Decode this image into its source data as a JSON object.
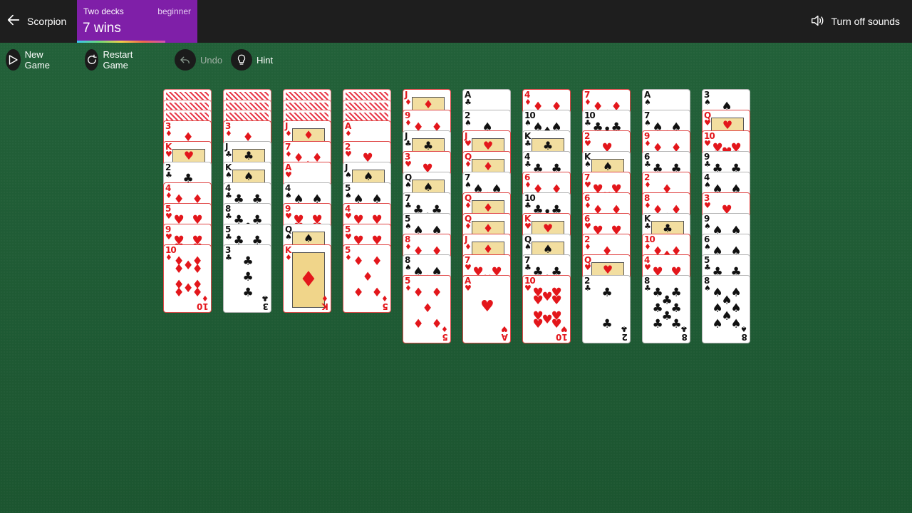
{
  "header": {
    "game_title": "Scorpion",
    "decks": "Two decks",
    "level": "beginner",
    "wins": "7 wins",
    "sound": "Turn off sounds"
  },
  "toolbar": {
    "new_game": "New Game",
    "restart": "Restart Game",
    "undo": "Undo",
    "hint": "Hint"
  },
  "columns": [
    {
      "down": 3,
      "up": [
        "3♦",
        "K♥",
        "2♣",
        "4♦",
        "5♥",
        "9♥",
        "10♦"
      ]
    },
    {
      "down": 3,
      "up": [
        "3♦",
        "J♣",
        "K♠",
        "4♣",
        "8♣",
        "5♣",
        "3♣"
      ]
    },
    {
      "down": 3,
      "up": [
        "J♦",
        "7♦",
        "A♥",
        "4♠",
        "9♥",
        "Q♠",
        "K♦"
      ]
    },
    {
      "down": 3,
      "up": [
        "A♦",
        "2♥",
        "J♠",
        "5♠",
        "4♥",
        "5♥",
        "5♦"
      ]
    },
    {
      "down": 0,
      "up": [
        "J♦",
        "9♦",
        "J♣",
        "3♥",
        "Q♠",
        "7♣",
        "5♠",
        "8♦",
        "8♠",
        "5♦"
      ]
    },
    {
      "down": 0,
      "up": [
        "A♣",
        "2♠",
        "J♥",
        "Q♦",
        "7♠",
        "Q♦",
        "Q♦",
        "J♦",
        "7♥",
        "A♥"
      ]
    },
    {
      "down": 0,
      "up": [
        "4♦",
        "10♠",
        "K♣",
        "4♣",
        "6♦",
        "10♣",
        "K♥",
        "Q♠",
        "7♣",
        "10♥"
      ]
    },
    {
      "down": 0,
      "up": [
        "7♦",
        "10♣",
        "2♥",
        "K♠",
        "7♥",
        "6♦",
        "6♥",
        "2♦",
        "Q♥",
        "2♣"
      ]
    },
    {
      "down": 0,
      "up": [
        "A♠",
        "7♠",
        "9♦",
        "6♣",
        "2♦",
        "8♦",
        "K♣",
        "10♦",
        "4♥",
        "8♣"
      ]
    },
    {
      "down": 0,
      "up": [
        "3♠",
        "Q♥",
        "10♥",
        "9♣",
        "4♠",
        "3♥",
        "9♠",
        "6♠",
        "5♣",
        "8♠"
      ]
    }
  ]
}
